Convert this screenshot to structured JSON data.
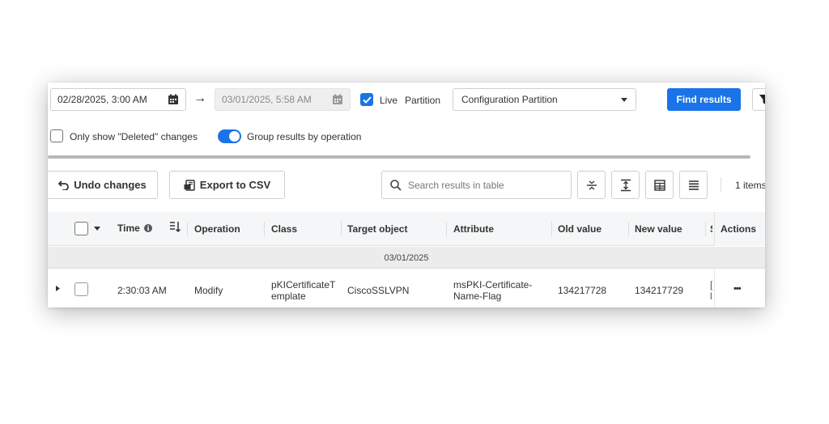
{
  "toolbar": {
    "start_date": "02/28/2025, 3:00 AM",
    "end_date": "03/01/2025, 5:58 AM",
    "arrow": "→",
    "live_label": "Live",
    "live_checked": true,
    "partition_label": "Partition",
    "partition_value": "Configuration Partition",
    "find_label": "Find results",
    "only_deleted_label": "Only show \"Deleted\" changes",
    "group_label": "Group results by operation"
  },
  "actions": {
    "undo_label": "Undo changes",
    "export_label": "Export to CSV",
    "search_placeholder": "Search results in table",
    "items_count": "1 items"
  },
  "table": {
    "headers": {
      "time": "Time",
      "operation": "Operation",
      "class": "Class",
      "target": "Target object",
      "attribute": "Attribute",
      "old_value": "Old value",
      "new_value": "New value",
      "s": "S",
      "actions": "Actions"
    },
    "group_date": "03/01/2025",
    "row": {
      "time": "2:30:03 AM",
      "operation": "Modify",
      "class_line1": "pKICertificateT",
      "class_line2": "emplate",
      "target": "CiscoSSLVPN",
      "attribute_line1": "msPKI-Certificate-",
      "attribute_line2": "Name-Flag",
      "old_value": "134217728",
      "new_value": "134217729",
      "s_line1": "[",
      "s_line2": "l",
      "actions": "•••"
    }
  },
  "colors": {
    "primary": "#1a73e8",
    "progress": "#b8b8b8"
  }
}
